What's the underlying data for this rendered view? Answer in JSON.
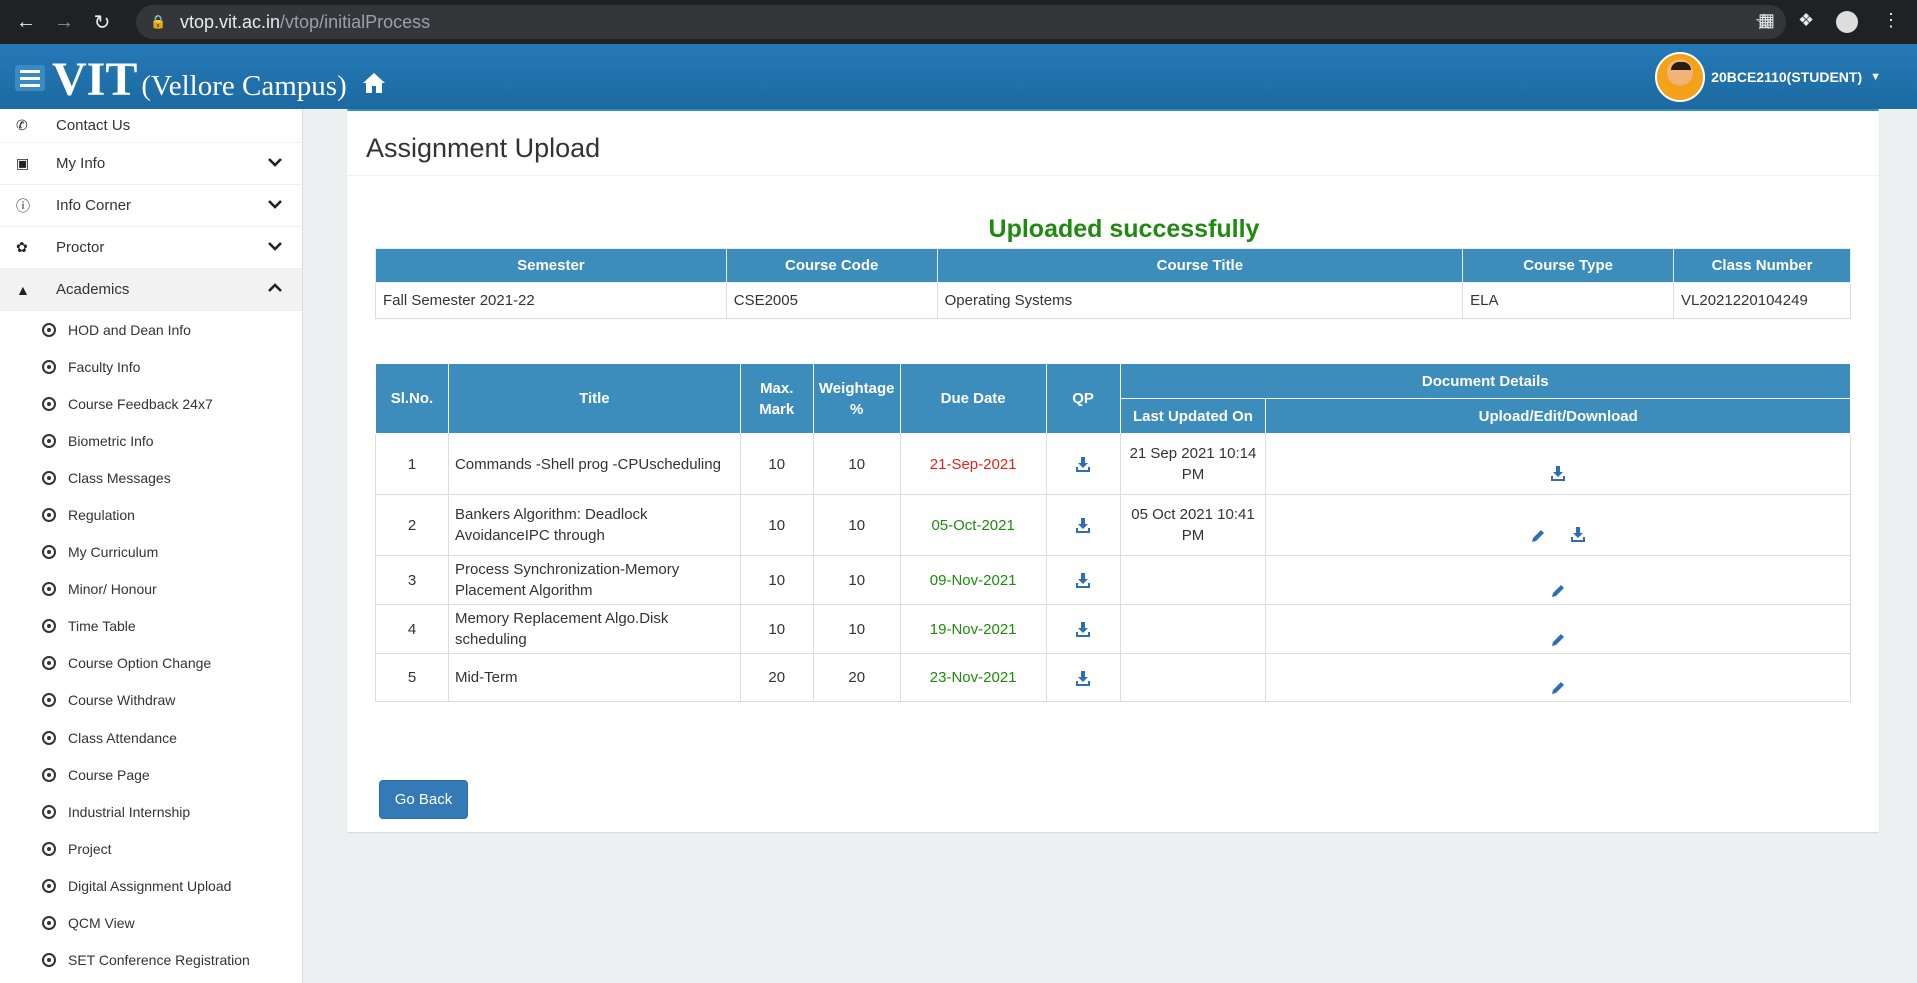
{
  "browser": {
    "url_domain": "vtop.vit.ac.in",
    "url_path": "/vtop/initialProcess",
    "icons": [
      "back-icon",
      "forward-icon",
      "reload-icon",
      "lock-icon",
      "star-icon",
      "extension-icon",
      "puzzle-icon",
      "profile-icon",
      "menu-icon"
    ]
  },
  "header": {
    "brand_big": "VIT",
    "brand_small": "(Vellore Campus)",
    "user": "20BCE2110(STUDENT)"
  },
  "sidebar": {
    "top": {
      "label": "Contact Us",
      "icon": "phone-icon"
    },
    "main": [
      {
        "label": "My Info",
        "icon": "briefcase-icon"
      },
      {
        "label": "Info Corner",
        "icon": "info-icon"
      },
      {
        "label": "Proctor",
        "icon": "paw-icon"
      },
      {
        "label": "Academics",
        "icon": "graduation-cap-icon",
        "expanded": true
      }
    ],
    "sub": [
      "HOD and Dean Info",
      "Faculty Info",
      "Course Feedback 24x7",
      "Biometric Info",
      "Class Messages",
      "Regulation",
      "My Curriculum",
      "Minor/ Honour",
      "Time Table",
      "Course Option Change",
      "Course Withdraw",
      "Class Attendance",
      "Course Page",
      "Industrial Internship",
      "Project",
      "Digital Assignment Upload",
      "QCM View",
      "SET Conference Registration"
    ]
  },
  "panel": {
    "title": "Assignment Upload",
    "status": "Uploaded successfully",
    "course_headers": [
      "Semester",
      "Course Code",
      "Course Title",
      "Course Type",
      "Class Number"
    ],
    "course": [
      "Fall Semester 2021-22",
      "CSE2005",
      "Operating Systems",
      "ELA",
      "VL2021220104249"
    ],
    "assign_headers": {
      "slno": "Sl.No.",
      "title": "Title",
      "max_mark": "Max. Mark",
      "weightage": "Weightage %",
      "due_date": "Due Date",
      "qp": "QP",
      "doc_details": "Document Details",
      "last_updated": "Last Updated On",
      "upload": "Upload/Edit/Download"
    },
    "assignments": [
      {
        "slno": "1",
        "title": "Commands -Shell prog -CPUscheduling",
        "max": "10",
        "weight": "10",
        "due": "21-Sep-2021",
        "due_color": "red",
        "updated": "21 Sep 2021 10:14 PM",
        "edit": false,
        "download": true
      },
      {
        "slno": "2",
        "title": "Bankers Algorithm: Deadlock AvoidanceIPC through",
        "max": "10",
        "weight": "10",
        "due": "05-Oct-2021",
        "due_color": "green",
        "updated": "05 Oct 2021 10:41 PM",
        "edit": true,
        "download": true
      },
      {
        "slno": "3",
        "title": "Process Synchronization-Memory Placement Algorithm",
        "max": "10",
        "weight": "10",
        "due": "09-Nov-2021",
        "due_color": "green",
        "updated": "",
        "edit": true,
        "download": false
      },
      {
        "slno": "4",
        "title": "Memory Replacement Algo.Disk scheduling",
        "max": "10",
        "weight": "10",
        "due": "19-Nov-2021",
        "due_color": "green",
        "updated": "",
        "edit": true,
        "download": false
      },
      {
        "slno": "5",
        "title": "Mid-Term",
        "max": "20",
        "weight": "20",
        "due": "23-Nov-2021",
        "due_color": "green",
        "updated": "",
        "edit": true,
        "download": false
      }
    ],
    "go_back": "Go Back"
  },
  "colors": {
    "header": "#1e6fa8",
    "table_header": "#3c8dbc",
    "success": "#1f8a0f",
    "overdue": "#e3221a",
    "button": "#337ab7"
  }
}
